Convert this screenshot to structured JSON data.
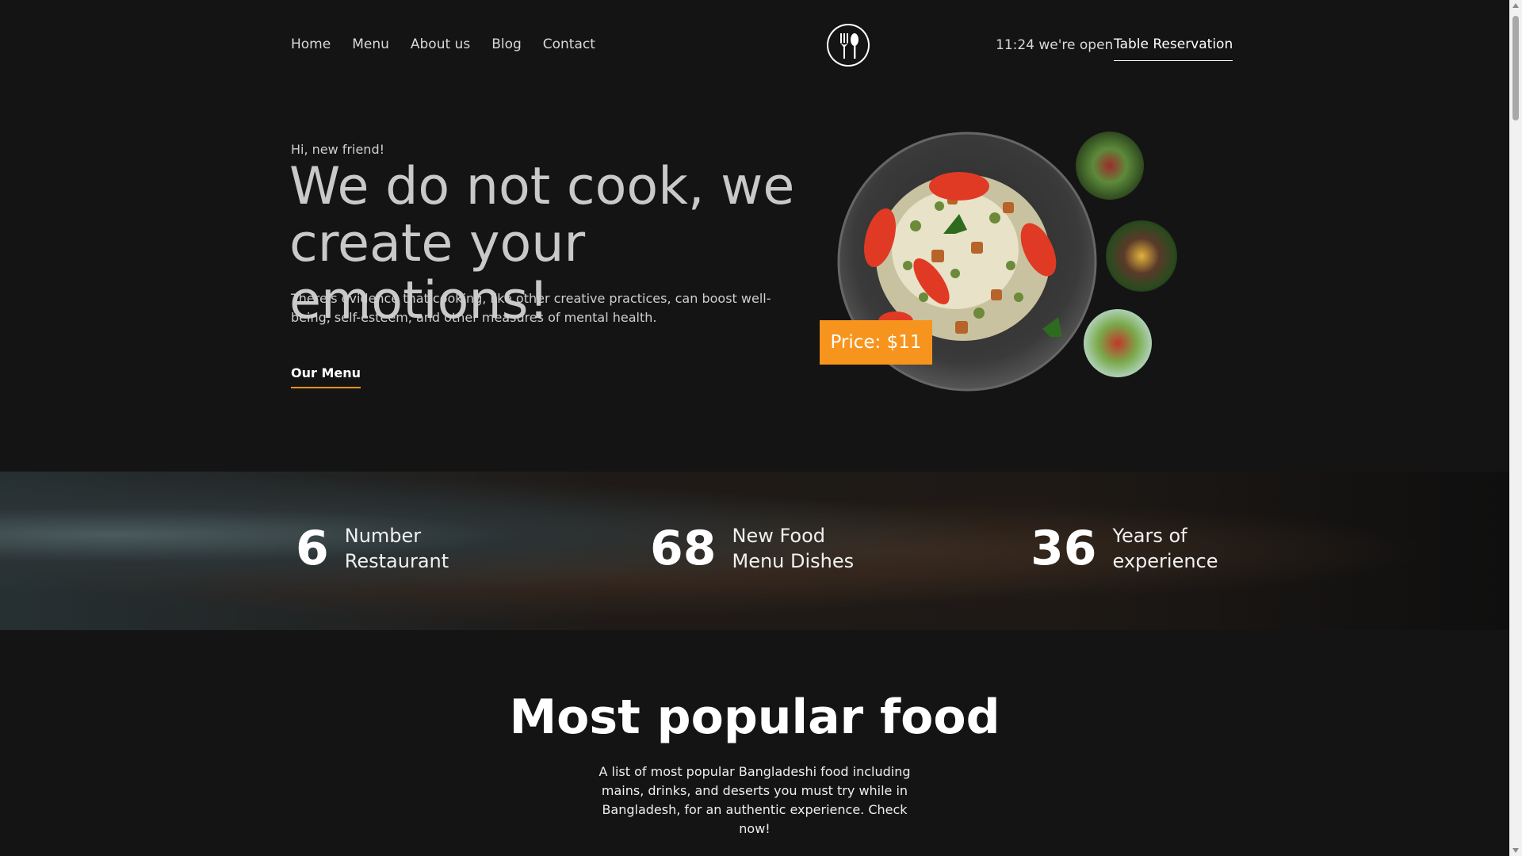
{
  "nav": {
    "items": [
      {
        "label": "Home"
      },
      {
        "label": "Menu"
      },
      {
        "label": "About us"
      },
      {
        "label": "Blog"
      },
      {
        "label": "Contact"
      }
    ]
  },
  "header": {
    "logo_icon": "fork-spoon-icon",
    "open_status": "11:24 we're open",
    "reservation_label": "Table Reservation"
  },
  "hero": {
    "greeting": "Hi, new friend!",
    "title": "We do not cook, we create your emotions!",
    "description": "There's evidence that cooking, like other creative practices, can boost well-being, self-esteem, and other measures of mental health.",
    "cta_label": "Our Menu",
    "price_label": "Price: $11"
  },
  "stats": [
    {
      "number": "6",
      "label": "Number Restaurant"
    },
    {
      "number": "68",
      "label": "New Food Menu Dishes"
    },
    {
      "number": "36",
      "label": "Years of experience"
    }
  ],
  "popular": {
    "title": "Most popular food",
    "description": "A list of most popular Bangladeshi food including mains, drinks, and deserts you must try while in Bangladesh, for an authentic experience. Check now!"
  },
  "colors": {
    "background": "#141414",
    "accent": "#f7941d",
    "text": "#ffffff"
  }
}
